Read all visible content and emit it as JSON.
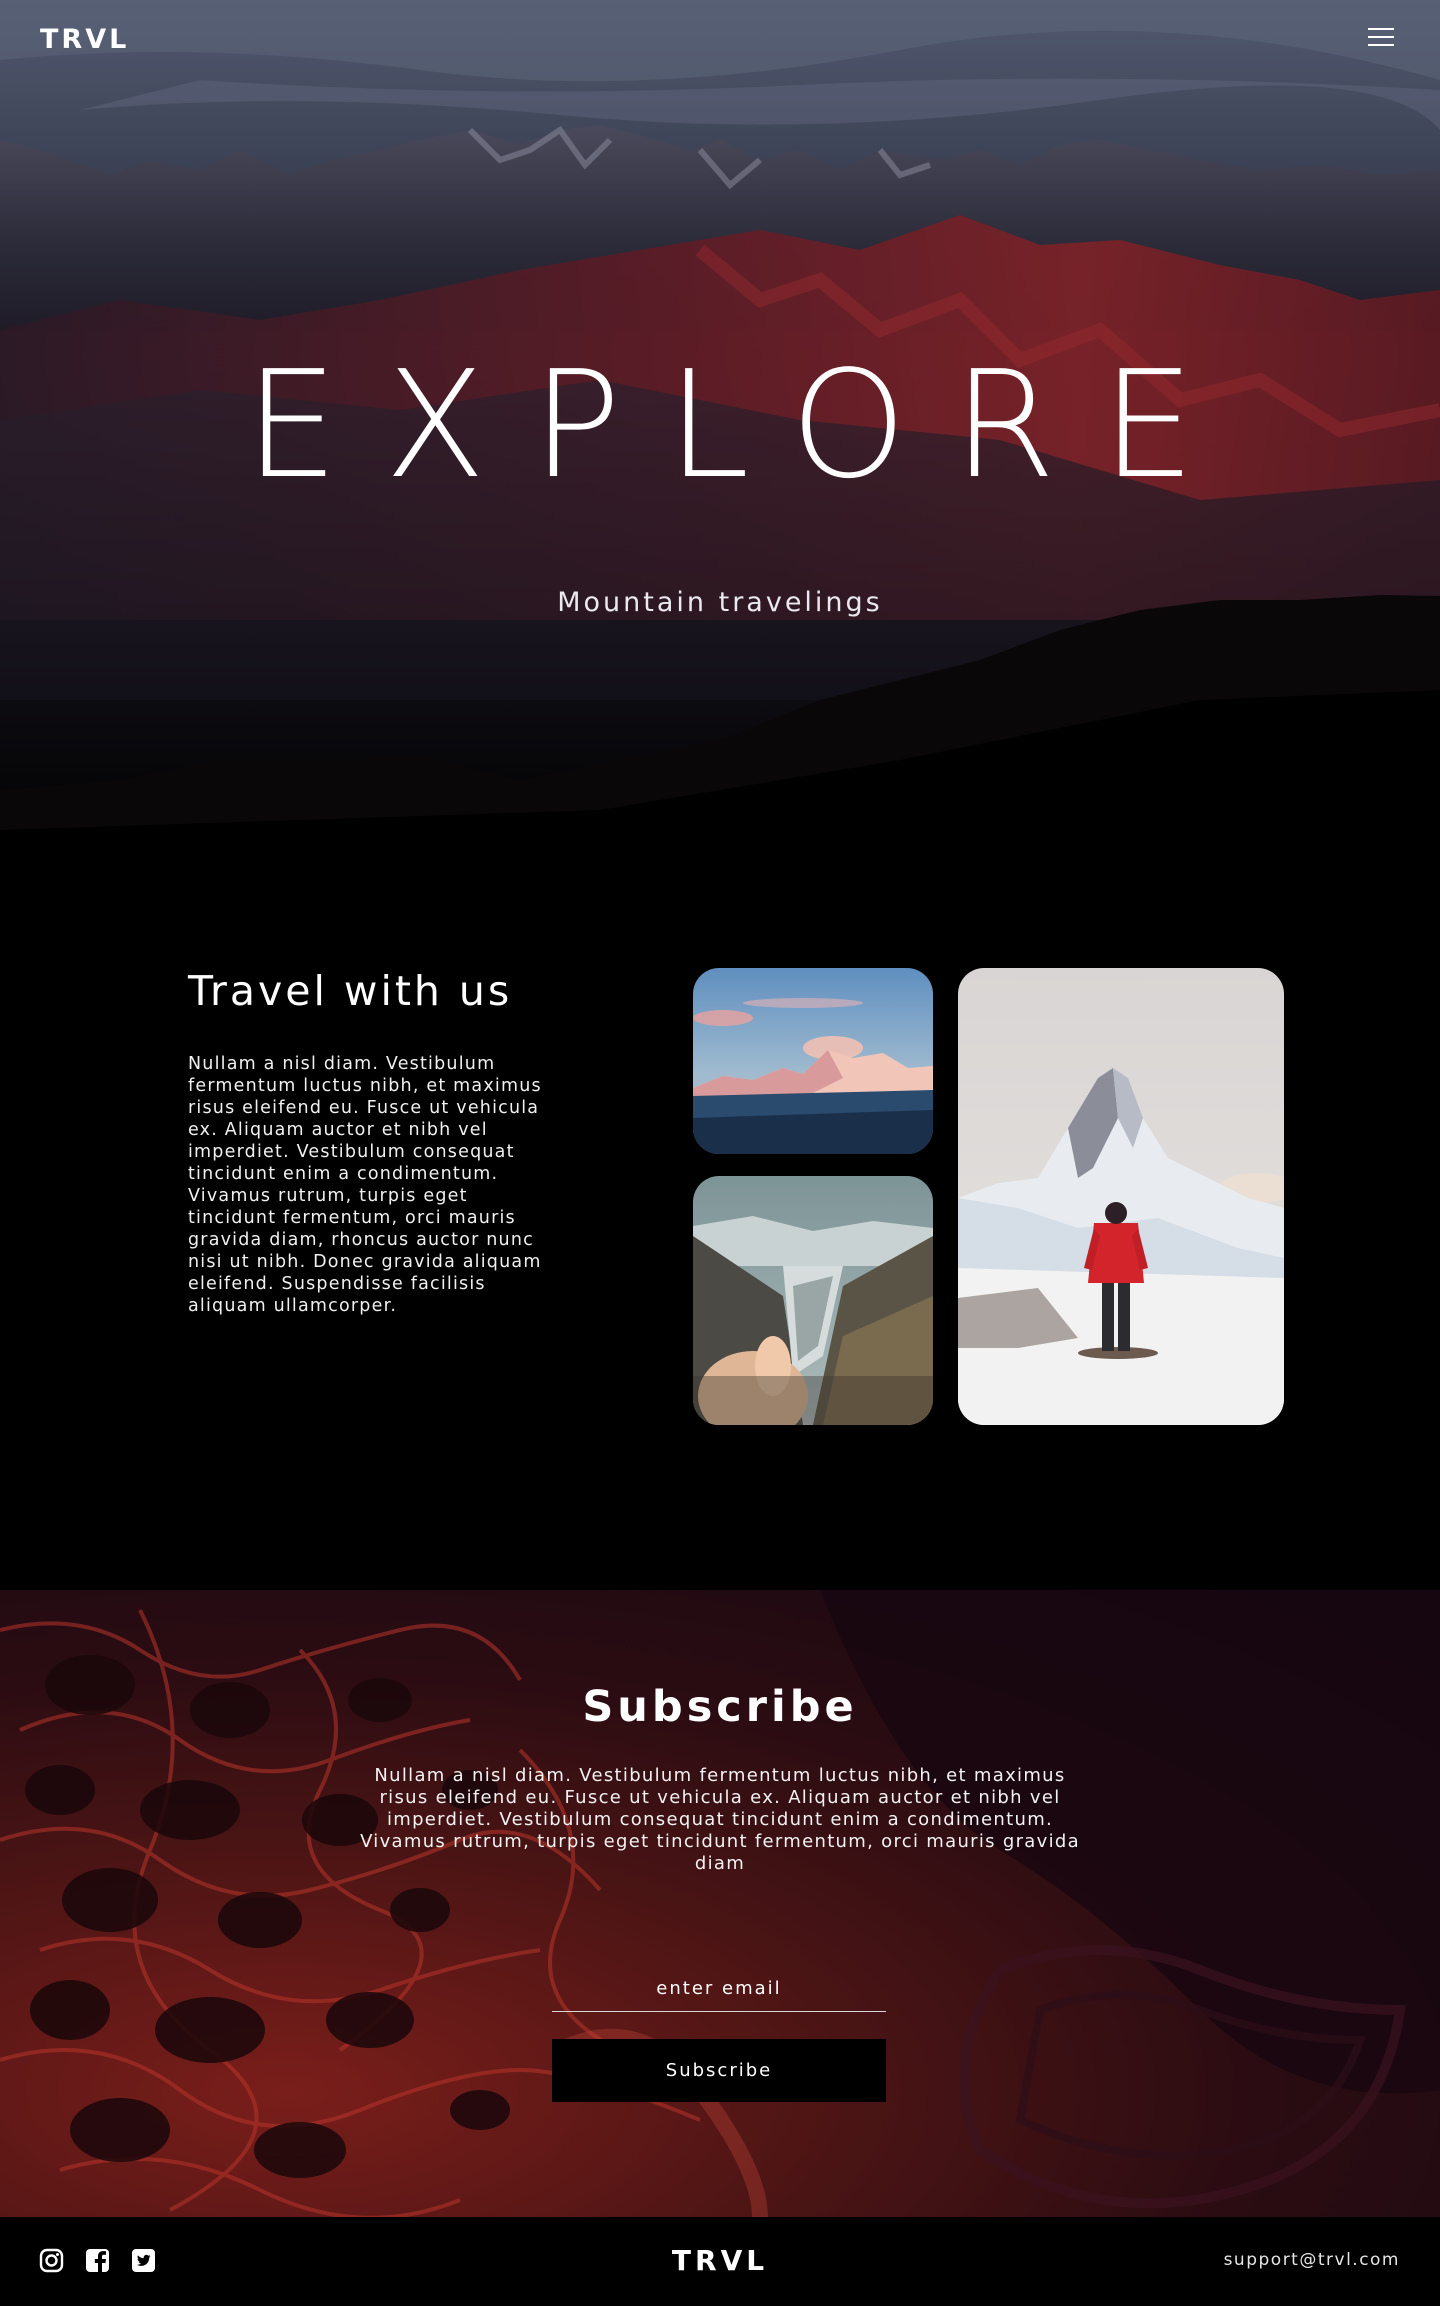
{
  "header": {
    "logo": "TRVL",
    "menu_icon": "hamburger-menu-icon"
  },
  "hero": {
    "title": "EXPLORE",
    "subtitle": "Mountain travelings"
  },
  "travel": {
    "heading": "Travel with us",
    "body": "Nullam a nisl diam. Vestibulum fermentum luctus nibh, et maximus risus eleifend eu. Fusce ut vehicula ex. Aliquam auctor et nibh vel imperdiet. Vestibulum consequat tincidunt enim a condimentum. Vivamus rutrum, turpis eget tincidunt fermentum, orci mauris gravida diam, rhoncus auctor nunc nisi ut nibh. Donec gravida aliquam eleifend. Suspendisse facilisis aliquam ullamcorper."
  },
  "subscribe": {
    "heading": "Subscribe",
    "body": "Nullam a nisl diam. Vestibulum fermentum luctus nibh, et maximus risus eleifend eu. Fusce ut vehicula ex. Aliquam auctor et nibh vel imperdiet. Vestibulum consequat tincidunt enim a condimentum. Vivamus rutrum, turpis eget tincidunt fermentum, orci mauris gravida diam",
    "email_placeholder": "enter email",
    "button_label": "Subscribe"
  },
  "footer": {
    "social_icons": [
      "instagram-icon",
      "facebook-icon",
      "twitter-icon"
    ],
    "logo": "TRVL",
    "email": "support@trvl.com"
  },
  "colors": {
    "background": "#000000",
    "text": "#ffffff",
    "accent_red": "#8a1f1f"
  }
}
